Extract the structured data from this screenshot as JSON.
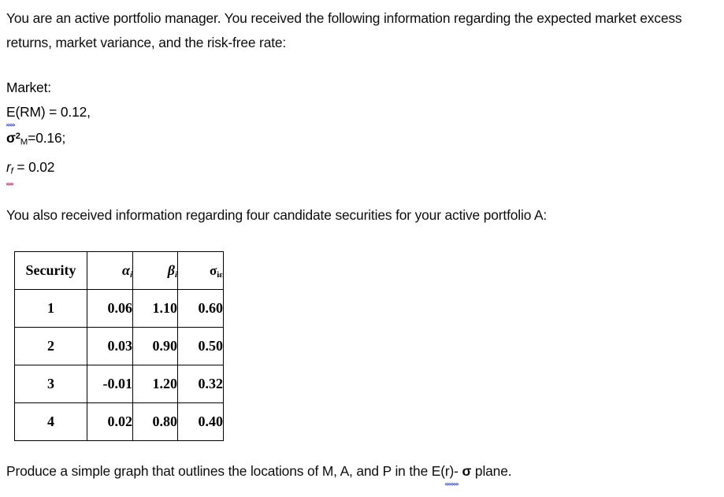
{
  "document": {
    "intro_paragraph": "You are an active portfolio manager. You received the following information regarding the expected market excess returns, market variance, and the risk-free rate:",
    "market": {
      "heading": "Market:",
      "expected_return": {
        "symbol_head": "E",
        "symbol_tail": "(RM)",
        "equals": " = ",
        "value": "0.12,"
      },
      "variance": {
        "symbol": "σ",
        "superscript": "2",
        "subscript": "M",
        "equals": "=",
        "value": "0.16;"
      },
      "risk_free": {
        "symbol": "r",
        "subscript": "f",
        "equals": " = ",
        "value": "0.02"
      }
    },
    "candidates_paragraph": "You also received information regarding four candidate securities for your active portfolio A:",
    "produce_paragraph": {
      "before": "Produce a simple graph that outlines the locations of M, A, and P in the E(",
      "squiggle": "r)-",
      "sigma": "σ",
      "after": " plane."
    }
  },
  "table": {
    "columns": [
      {
        "label": "Security",
        "symbol": "",
        "subscript": ""
      },
      {
        "label": "",
        "symbol": "α",
        "subscript": "i"
      },
      {
        "label": "",
        "symbol": "β",
        "subscript": "i"
      },
      {
        "label": "",
        "symbol": "σ",
        "subscript": "iε"
      }
    ],
    "rows": [
      {
        "security": "1",
        "alpha": "0.06",
        "beta": "1.10",
        "sigma": "0.60"
      },
      {
        "security": "2",
        "alpha": "0.03",
        "beta": "0.90",
        "sigma": "0.50"
      },
      {
        "security": "3",
        "alpha": "-0.01",
        "beta": "1.20",
        "sigma": "0.32"
      },
      {
        "security": "4",
        "alpha": "0.02",
        "beta": "0.80",
        "sigma": "0.40"
      }
    ]
  },
  "colors": {
    "text": "#0d0d0d",
    "spell_grammar": "#2b40c8",
    "spell_error": "#b01a5b",
    "table_border": "#000000",
    "background": "#ffffff"
  }
}
